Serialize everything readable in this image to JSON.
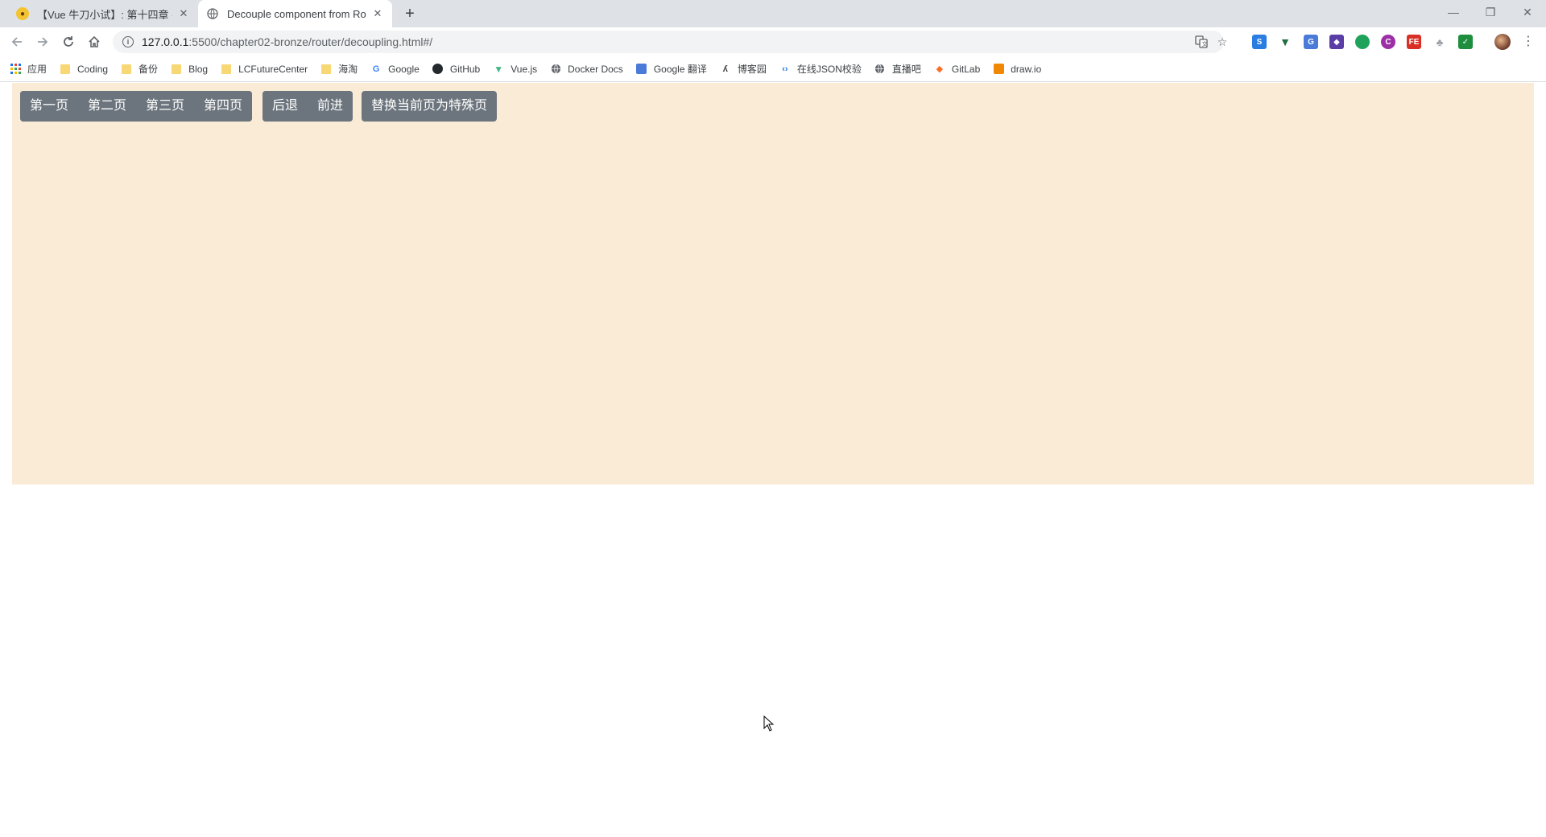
{
  "browser": {
    "tabs": [
      {
        "title": "【Vue 牛刀小试】: 第十四章 - ",
        "favicon": "hedgehog-icon",
        "active": false
      },
      {
        "title": "Decouple component from Ro",
        "favicon": "globe-icon",
        "active": true
      }
    ],
    "new_tab_symbol": "+",
    "window_controls": {
      "minimize": "—",
      "restore": "❐",
      "close": "✕"
    },
    "address": {
      "host": "127.0.0.1",
      "path": ":5500/chapter02-bronze/router/decoupling.html#/"
    },
    "bookmarks": [
      {
        "label": "应用",
        "icon": "apps-icon"
      },
      {
        "label": "Coding",
        "icon": "folder-icon"
      },
      {
        "label": "备份",
        "icon": "folder-icon"
      },
      {
        "label": "Blog",
        "icon": "folder-icon"
      },
      {
        "label": "LCFutureCenter",
        "icon": "folder-icon"
      },
      {
        "label": "海淘",
        "icon": "folder-icon"
      },
      {
        "label": "Google",
        "icon": "google-icon"
      },
      {
        "label": "GitHub",
        "icon": "github-icon"
      },
      {
        "label": "Vue.js",
        "icon": "vue-icon"
      },
      {
        "label": "Docker Docs",
        "icon": "globe-icon"
      },
      {
        "label": "Google 翻译",
        "icon": "translate-icon"
      },
      {
        "label": "博客园",
        "icon": "cnblogs-icon"
      },
      {
        "label": "在线JSON校验",
        "icon": "code-icon"
      },
      {
        "label": "直播吧",
        "icon": "globe-icon"
      },
      {
        "label": "GitLab",
        "icon": "gitlab-icon"
      },
      {
        "label": "draw.io",
        "icon": "drawio-icon"
      }
    ]
  },
  "page": {
    "background": "#faebd7",
    "nav_buttons": [
      "第一页",
      "第二页",
      "第三页",
      "第四页"
    ],
    "history_buttons": [
      "后退",
      "前进"
    ],
    "replace_button": "替换当前页为特殊页",
    "button_color": "#6c757d"
  }
}
